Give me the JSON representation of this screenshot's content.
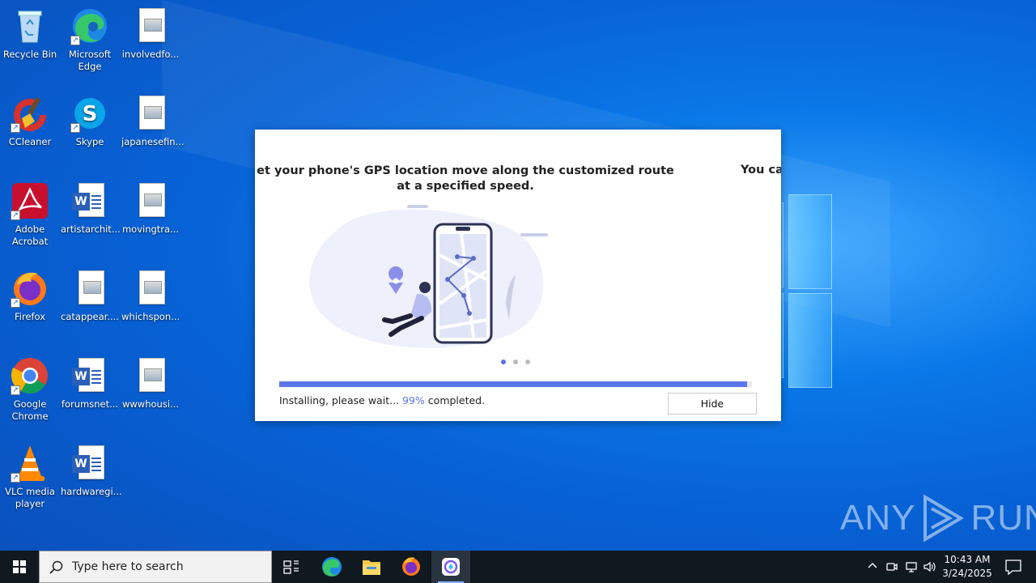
{
  "desktop": {
    "icons": [
      {
        "label": "Recycle Bin"
      },
      {
        "label": "Microsoft Edge"
      },
      {
        "label": "involvedfo..."
      },
      {
        "label": "CCleaner"
      },
      {
        "label": "Skype"
      },
      {
        "label": "japanesefin..."
      },
      {
        "label": "Adobe Acrobat"
      },
      {
        "label": "artistarchit..."
      },
      {
        "label": "movingtra..."
      },
      {
        "label": "Firefox"
      },
      {
        "label": "catappear...."
      },
      {
        "label": "whichspon..."
      },
      {
        "label": "Google Chrome"
      },
      {
        "label": "forumsnet..."
      },
      {
        "label": "wwwhousi..."
      },
      {
        "label": "VLC media player"
      },
      {
        "label": "hardwaregi..."
      }
    ]
  },
  "installer": {
    "slide_text": "et your phone's GPS location move along the customized route at a specified speed.",
    "next_slide_text": "You ca",
    "slide_count": 3,
    "active_slide": 1,
    "progress_percent": 99,
    "status_prefix": "Installing, please wait...",
    "status_percent": "99%",
    "status_suffix": "completed.",
    "hide_label": "Hide",
    "accent_color": "#5b76e6"
  },
  "watermark": {
    "text": "ANY",
    "text2": "RUN"
  },
  "taskbar": {
    "search_placeholder": "Type here to search",
    "pinned": [
      "task-view-icon",
      "edge-icon",
      "file-explorer-icon",
      "firefox-icon",
      "installer-app-icon"
    ],
    "time": "10:43 AM",
    "date": "3/24/2025"
  }
}
